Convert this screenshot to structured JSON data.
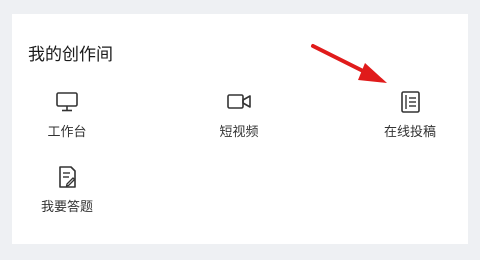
{
  "section": {
    "title": "我的创作间"
  },
  "tiles": [
    {
      "label": "工作台",
      "icon": "monitor-icon"
    },
    {
      "label": "短视频",
      "icon": "video-camera-icon"
    },
    {
      "label": "在线投稿",
      "icon": "document-icon"
    },
    {
      "label": "我要答题",
      "icon": "edit-document-icon"
    }
  ],
  "colors": {
    "accent_arrow": "#e01b1b",
    "icon": "#333333"
  }
}
